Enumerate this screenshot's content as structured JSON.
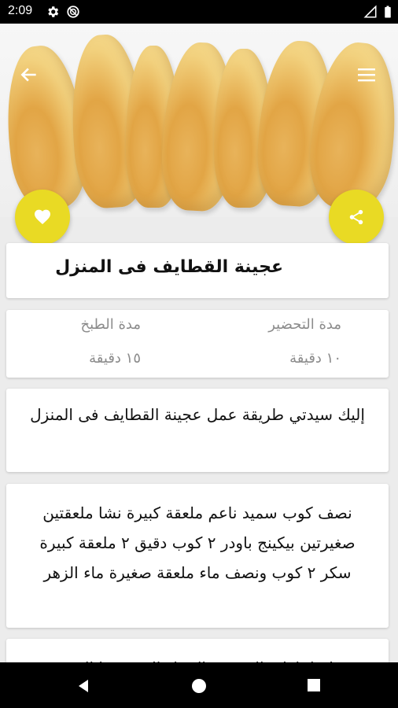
{
  "status_bar": {
    "time": "2:09"
  },
  "recipe": {
    "title": "عجينة القطايف فى المنزل",
    "prep_label": "مدة التحضير",
    "prep_value": "١٠ دقيقة",
    "cook_label": "مدة الطبخ",
    "cook_value": "١٥ دقيقة",
    "intro": "إليك سيدتي طريقة عمل عجينة القطايف فى المنزل",
    "ingredients": "نصف كوب سميد ناعم ملعقة كبيرة نشا ملعقتين صغيرتين بيكينج باودر ٢ كوب دقيق ٢ ملعقة كبيرة سكر ٢ كوب ونصف ماء ملعقة صغيرة ماء الزهر",
    "next_step_partial": "ام اخلطي السميد والنشا والبقية عدا النجو"
  },
  "colors": {
    "accent": "#e9da24",
    "card_bg": "#ffffff",
    "page_bg": "#ececec"
  },
  "icons": {
    "back": "arrow-back-icon",
    "menu": "hamburger-menu-icon",
    "like": "heart-icon",
    "share": "share-icon",
    "settings": "gear-icon",
    "dnd": "do-not-disturb-icon",
    "signal": "signal-icon",
    "battery": "battery-icon",
    "nav_back": "triangle-back-icon",
    "nav_home": "circle-home-icon",
    "nav_recents": "square-recents-icon"
  }
}
